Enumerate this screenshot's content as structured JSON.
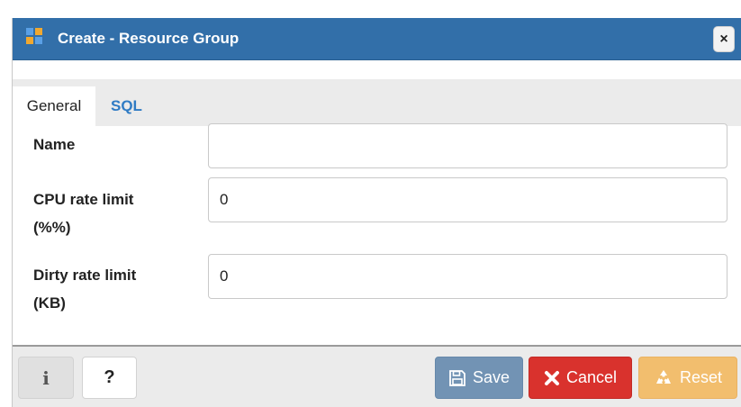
{
  "dialog": {
    "title": "Create - Resource Group",
    "close_label": "×"
  },
  "tabs": [
    {
      "label": "General",
      "active": true
    },
    {
      "label": "SQL",
      "active": false
    }
  ],
  "form": {
    "name": {
      "label": "Name",
      "value": ""
    },
    "cpu_rate_limit": {
      "label_line1": "CPU rate limit",
      "label_line2": "(%%)",
      "value": "0"
    },
    "dirty_rate_limit": {
      "label_line1": "Dirty rate limit",
      "label_line2": "(KB)",
      "value": "0"
    }
  },
  "footer": {
    "info_label": "i",
    "help_label": "?",
    "save_label": "Save",
    "cancel_label": "Cancel",
    "reset_label": "Reset"
  },
  "colors": {
    "titlebar": "#326fa9",
    "tab_active_text": "#2f7bc4",
    "save": "#7293b4",
    "cancel": "#d9322d",
    "reset": "#f2be6e"
  },
  "icons": {
    "app": "resource-group-icon",
    "save": "floppy-disk-icon",
    "cancel": "x-mark-icon",
    "reset": "recycle-icon"
  }
}
